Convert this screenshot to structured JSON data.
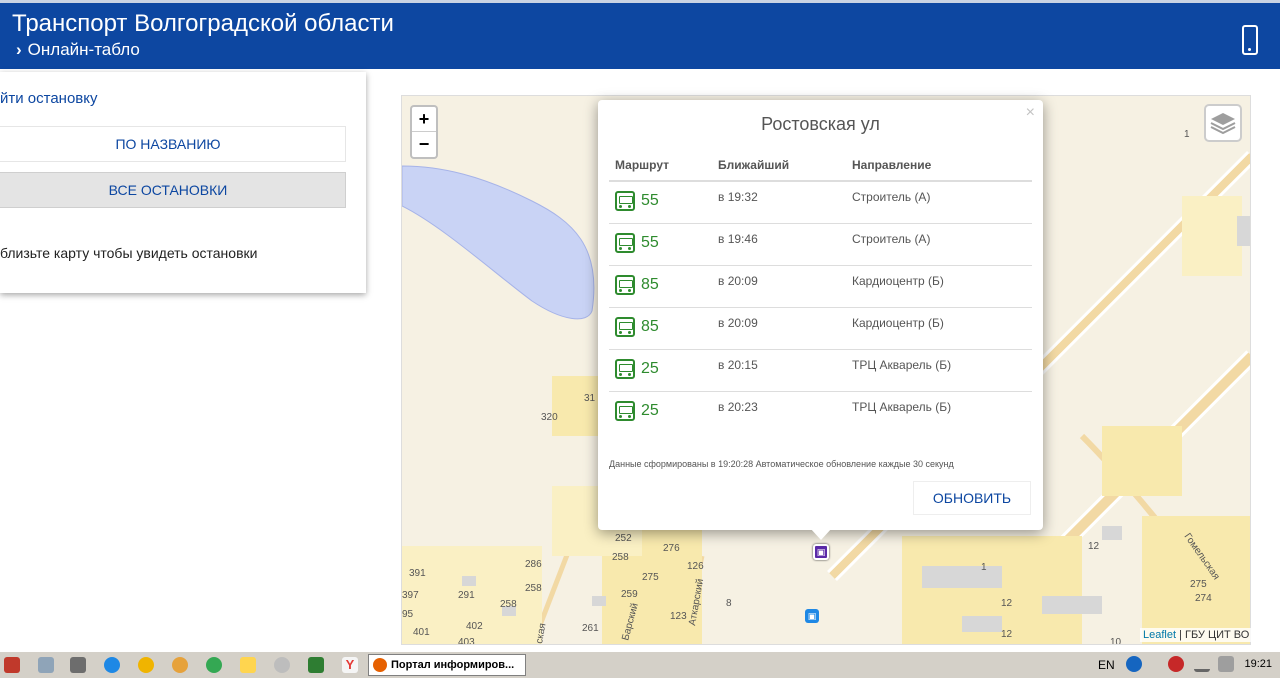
{
  "header": {
    "title": "Транспорт Волгоградской области",
    "subtitle": "Онлайн-табло",
    "phone_icon": "mobile-phone-icon"
  },
  "panel": {
    "find_label": "йти остановку",
    "by_name_button": "ПО НАЗВАНИЮ",
    "all_stops_button": "ВСЕ ОСТАНОВКИ",
    "hint": "близьте карту чтобы увидеть остановки"
  },
  "map": {
    "zoom_in": "+",
    "zoom_out": "−",
    "attribution_link": "Leaflet",
    "attribution_text": " | ГБУ ЦИТ ВО",
    "street_labels": [
      "Гомельская",
      "Аткарский",
      "Барский",
      "ская"
    ],
    "house_numbers": [
      "320",
      "31",
      "252",
      "258",
      "276",
      "286",
      "258",
      "391",
      "397",
      "291",
      "258",
      "275",
      "126",
      "259",
      "123",
      "261",
      "401",
      "402",
      "403",
      "95",
      "8",
      "12",
      "12",
      "12",
      "1",
      "275",
      "274",
      "10",
      "1"
    ]
  },
  "popup": {
    "title": "Ростовская ул",
    "close": "×",
    "columns": [
      "Маршрут",
      "Ближайший",
      "Направление"
    ],
    "rows": [
      {
        "route": "55",
        "time": "в 19:32",
        "direction": "Строитель (А)"
      },
      {
        "route": "55",
        "time": "в 19:46",
        "direction": "Строитель (А)"
      },
      {
        "route": "85",
        "time": "в 20:09",
        "direction": "Кардиоцентр (Б)"
      },
      {
        "route": "85",
        "time": "в 20:09",
        "direction": "Кардиоцентр (Б)"
      },
      {
        "route": "25",
        "time": "в 20:15",
        "direction": "ТРЦ Акварель (Б)"
      },
      {
        "route": "25",
        "time": "в 20:23",
        "direction": "ТРЦ Акварель (Б)"
      }
    ],
    "footer": "Данные сформированы в 19:20:28 Автоматическое обновление каждые 30 секунд",
    "refresh_button": "ОБНОВИТЬ"
  },
  "taskbar": {
    "task_title": "Портал информиров...",
    "lang": "EN",
    "clock": "19:21"
  }
}
